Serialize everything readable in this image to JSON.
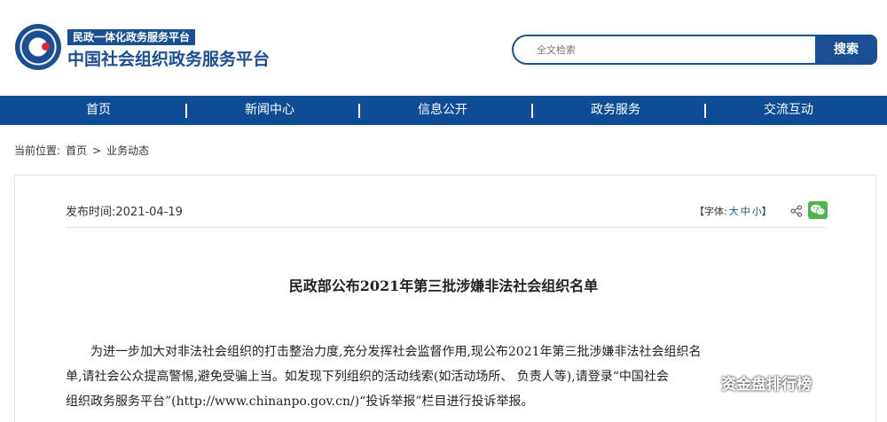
{
  "header": {
    "tagline": "民政一体化政务服务平台",
    "site_name": "中国社会组织政务服务平台",
    "search": {
      "placeholder": "全文检索",
      "button_label": "搜索"
    },
    "brand_color": "#1a4f93"
  },
  "nav": {
    "items": [
      "首页",
      "新闻中心",
      "信息公开",
      "政务服务",
      "交流互动"
    ]
  },
  "breadcrumb": {
    "label": "当前位置:",
    "home": "首页",
    "sep": ">",
    "current": "业务动态"
  },
  "article": {
    "pubdate": "发布时间:2021-04-19",
    "font_size": {
      "open": "【字体:",
      "big": "大",
      "mid": "中",
      "small": "小",
      "close": "】"
    },
    "title": "民政部公布2021年第三批涉嫌非法社会组织名单",
    "paragraph": [
      "为进一步加大对非法社会组织的打击整治力度,充分发挥社会监督作用,现公布2021年第三批涉嫌非法社会组织名",
      "单,请社会公众提高警惕,避免受骗上当。如发现下列组织的活动线索(如活动场所、 负责人等),请登录“中国社会",
      "组织政务服务平台”(http://www.chinanpo.gov.cn/)“投诉举报”栏目进行投诉举报。"
    ]
  },
  "watermark": {
    "text": "资金盘排行榜",
    "icon": "wechat-official-account-icon"
  }
}
